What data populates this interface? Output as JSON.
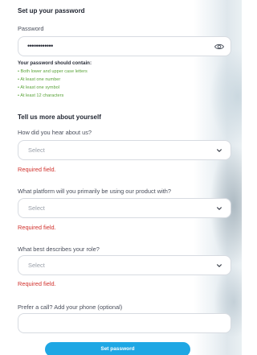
{
  "password_section": {
    "title": "Set up your password",
    "password_label": "Password",
    "password_value": "••••••••••••",
    "rules_title": "Your password should contain:",
    "rules": [
      "Both lower and upper case letters",
      "At least one number",
      "At least one symbol",
      "At least 12 characters"
    ]
  },
  "about_section": {
    "title": "Tell us more about yourself",
    "q1_label": "How did you hear about us?",
    "q1_value": "Select",
    "q1_error": "Required field.",
    "q2_label": "What platform will you primarily be using our product with?",
    "q2_value": "Select",
    "q2_error": "Required field.",
    "q3_label": "What best describes your role?",
    "q3_value": "Select",
    "q3_error": "Required field.",
    "phone_label": "Prefer a call? Add your phone (optional)",
    "phone_value": ""
  },
  "submit_label": "Set password",
  "colors": {
    "accent": "#1ea7e4",
    "error": "#d1312c",
    "rule_ok": "#5aa33a"
  }
}
